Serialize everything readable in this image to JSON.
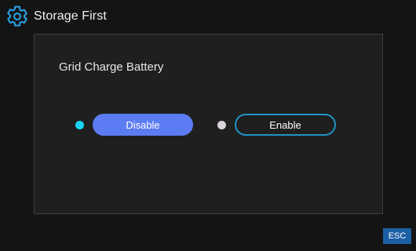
{
  "header": {
    "icon": "gear-icon",
    "title": "Storage First"
  },
  "panel": {
    "title": "Grid Charge Battery",
    "options": [
      {
        "label": "Disable",
        "selected": true,
        "indicator_color": "#18d4f0",
        "button_color": "#5c7cf3"
      },
      {
        "label": "Enable",
        "selected": false,
        "indicator_color": "#d8d3dc",
        "button_border_color": "#1e94c8"
      }
    ]
  },
  "esc_button": {
    "label": "ESC",
    "color": "#1d5fa6"
  },
  "colors": {
    "background": "#141414",
    "panel": "#1f1f1f",
    "panel_border": "#3f3f3f",
    "accent": "#1e94c8"
  }
}
